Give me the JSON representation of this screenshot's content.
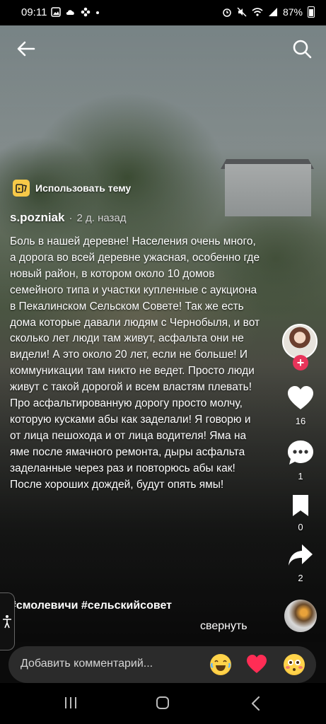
{
  "status_bar": {
    "time": "09:11",
    "battery": "87%"
  },
  "header": {
    "back_icon": "arrow-left-icon",
    "search_icon": "search-icon"
  },
  "theme": {
    "label": "Использовать тему"
  },
  "post": {
    "author": "s.pozniak",
    "separator": "·",
    "posted_ago": "2 д. назад",
    "caption": "Боль в нашей деревне! Населения очень много, а дорога во всей деревне ужасная, особенно где новый район, в котором около 10 домов семейного типа и участки купленные с аукциона в Пекалинском Сельском Совете! Так же есть дома которые давали людям с Чернобыля, и вот сколько лет люди там живут, асфальта они не видели! А это около 20 лет, если не больше! И коммуникации там никто не ведет. Просто люди живут с такой дорогой и всем властям плевать!\nПро асфальтированную дорогу просто молчу, которую кусками абы как заделали! Я говорю и от лица пешохода и от лица водителя! Яма на яме после ямачного ремонта, дыры асфальта заделанные через раз и повторюсь абы как! После хороших дождей, будут опять ямы!",
    "hashtags": "#смолевичи #сельскийсовет",
    "collapse_label": "свернуть"
  },
  "actions": {
    "follow_label": "+",
    "likes": "16",
    "comments": "1",
    "saves": "0",
    "shares": "2"
  },
  "comment_bar": {
    "placeholder": "Добавить комментарий..."
  },
  "colors": {
    "follow_badge": "#e8345a",
    "theme_icon": "#f7c948",
    "heart_emoji": "#ff2d55"
  }
}
